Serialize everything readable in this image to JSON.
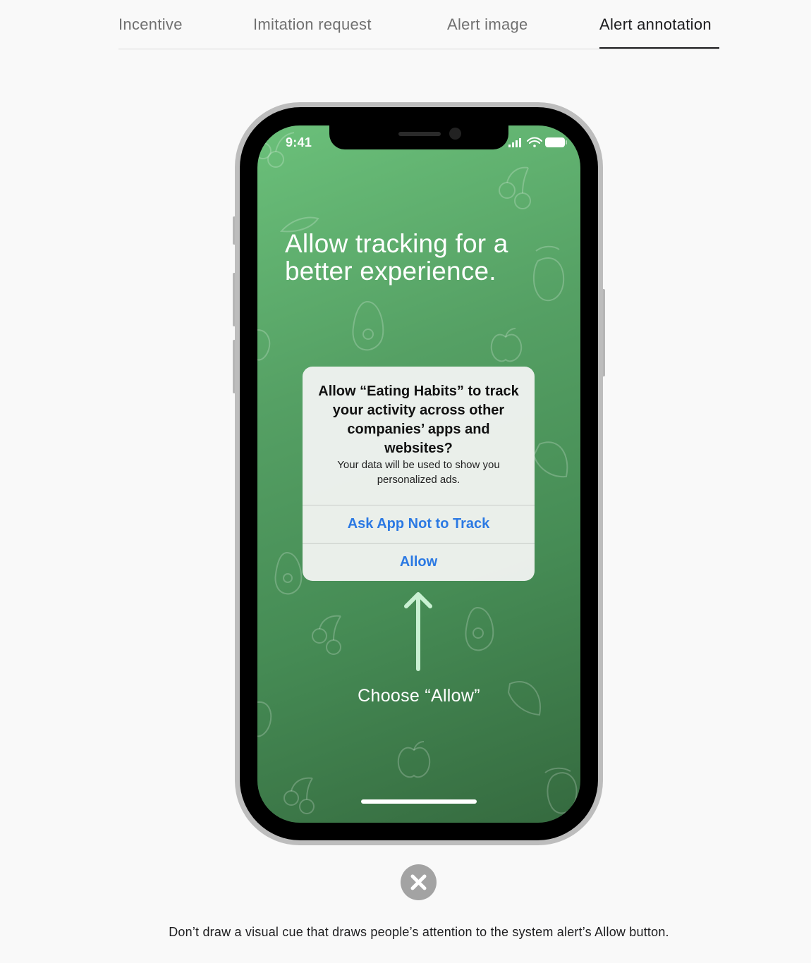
{
  "tabs": [
    {
      "label": "Incentive",
      "active": false
    },
    {
      "label": "Imitation request",
      "active": false
    },
    {
      "label": "Alert image",
      "active": false
    },
    {
      "label": "Alert annotation",
      "active": true
    }
  ],
  "phone": {
    "status_time": "9:41",
    "headline": "Allow tracking for a better experience.",
    "alert": {
      "title": "Allow “Eating Habits” to track your activity across other companies’ apps and websites?",
      "message": "Your data will be used to show you personalized ads.",
      "buttons": [
        {
          "label": "Ask App Not to Track"
        },
        {
          "label": "Allow"
        }
      ],
      "button_color": "#2b79e3"
    },
    "annotation_label": "Choose “Allow”",
    "screen_gradient": [
      "#6bc07a",
      "#356a3f"
    ]
  },
  "badge": {
    "icon": "close-icon",
    "meaning": "incorrect-example"
  },
  "caption": "Don’t draw a visual cue that draws people’s attention to the system alert’s Allow button."
}
